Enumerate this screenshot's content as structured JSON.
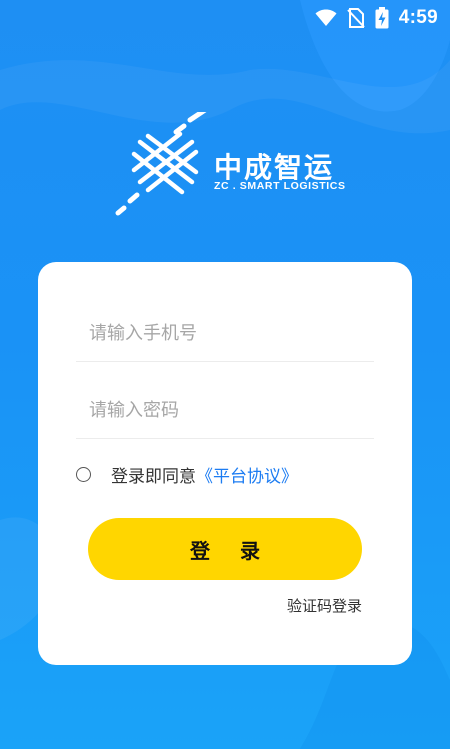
{
  "status_bar": {
    "time": "4:59",
    "icons": [
      "wifi-icon",
      "no-sim-icon",
      "battery-charging-icon"
    ]
  },
  "brand": {
    "logo_icon": "zc-woven-logo-icon",
    "title": "中成智运",
    "subtitle": "ZC . SMART LOGISTICS"
  },
  "login_form": {
    "phone_placeholder": "请输入手机号",
    "password_placeholder": "请输入密码",
    "agree_prefix": "登录即同意",
    "agreement_link": "《平台协议》",
    "login_button": "登录",
    "code_login_link": "验证码登录"
  },
  "colors": {
    "background": "#1a92f6",
    "button": "#ffd600",
    "link": "#1c7cf2"
  }
}
